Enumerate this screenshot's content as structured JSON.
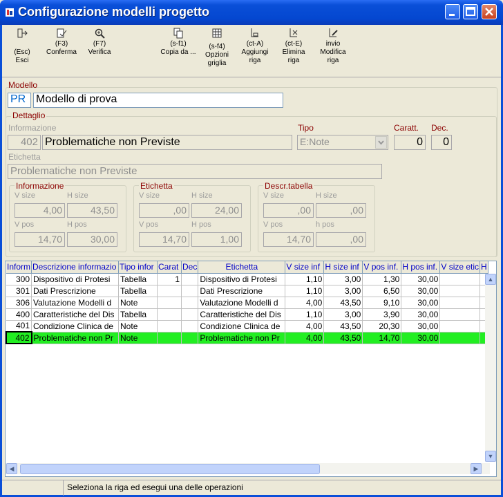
{
  "window": {
    "title": "Configurazione modelli progetto"
  },
  "toolbar": [
    {
      "shortcut": "(Esc)",
      "label": "Esci",
      "icon": "exit-icon"
    },
    {
      "shortcut": "(F3)",
      "label": "Conferma",
      "icon": "confirm-icon"
    },
    {
      "shortcut": "(F7)",
      "label": "Verifica",
      "icon": "verify-icon"
    },
    {
      "shortcut": "(s-f1)",
      "label": "Copia da ...",
      "icon": "copy-icon"
    },
    {
      "shortcut": "(s-f4)",
      "label": "Opzioni griglia",
      "icon": "grid-options-icon"
    },
    {
      "shortcut": "(ct-A)",
      "label": "Aggiungi riga",
      "icon": "add-row-icon"
    },
    {
      "shortcut": "(ct-E)",
      "label": "Elimina riga",
      "icon": "delete-row-icon"
    },
    {
      "shortcut": "invio",
      "label": "Modifica riga",
      "icon": "edit-row-icon"
    }
  ],
  "modello": {
    "label": "Modello",
    "code": "PR",
    "name": "Modello di prova"
  },
  "dettaglio": {
    "label": "Dettaglio",
    "informazione_label": "Informazione",
    "info_code": "402",
    "info_desc": "Problematiche non Previste",
    "tipo_label": "Tipo",
    "tipo_value": "E:Note",
    "caratt_label": "Caratt.",
    "caratt_value": "0",
    "dec_label": "Dec.",
    "dec_value": "0",
    "etichetta_label": "Etichetta",
    "etichetta_value": "Problematiche non Previste"
  },
  "groups": {
    "informazione": {
      "title": "Informazione",
      "vsize_label": "V size",
      "hsize_label": "H size",
      "vpos_label": "V pos",
      "hpos_label": "H pos",
      "vsize": "4,00",
      "hsize": "43,50",
      "vpos": "14,70",
      "hpos": "30,00"
    },
    "etichetta": {
      "title": "Etichetta",
      "vsize_label": "V size",
      "hsize_label": "H size",
      "vpos_label": "V pos",
      "hpos_label": "H pos",
      "vsize": ",00",
      "hsize": "24,00",
      "vpos": "14,70",
      "hpos": "1,00"
    },
    "descr": {
      "title": "Descr.tabella",
      "vsize_label": "V size",
      "hsize_label": "H size",
      "vpos_label": "V pos",
      "hpos_label": "h pos",
      "vsize": ",00",
      "hsize": ",00",
      "vpos": "14,70",
      "hpos": ",00"
    }
  },
  "grid": {
    "headers": [
      "Inform",
      "Descrizione informazio",
      "Tipo infor",
      "Carat",
      "Dec",
      "Etichetta",
      "V size inf",
      "H size inf",
      "V pos inf.",
      "H pos inf.",
      "V size etic",
      "H"
    ],
    "rows": [
      [
        "300",
        "Dispositivo di Protesi",
        "Tabella",
        "1",
        "",
        "Dispositivo di Protesi",
        "1,10",
        "3,00",
        "1,30",
        "30,00",
        "",
        ""
      ],
      [
        "301",
        "Dati Prescrizione",
        "Tabella",
        "",
        "",
        "Dati Prescrizione",
        "1,10",
        "3,00",
        "6,50",
        "30,00",
        "",
        ""
      ],
      [
        "306",
        "Valutazione Modelli d",
        "Note",
        "",
        "",
        "Valutazione Modelli d",
        "4,00",
        "43,50",
        "9,10",
        "30,00",
        "",
        ""
      ],
      [
        "400",
        "Caratteristiche del Dis",
        "Tabella",
        "",
        "",
        "Caratteristiche del Dis",
        "1,10",
        "3,00",
        "3,90",
        "30,00",
        "",
        ""
      ],
      [
        "401",
        "Condizione Clinica de",
        "Note",
        "",
        "",
        "Condizione Clinica de",
        "4,00",
        "43,50",
        "20,30",
        "30,00",
        "",
        ""
      ],
      [
        "402",
        "Problematiche non Pr",
        "Note",
        "",
        "",
        "Problematiche non Pr",
        "4,00",
        "43,50",
        "14,70",
        "30,00",
        "",
        ""
      ]
    ],
    "selected_row": 5
  },
  "status": {
    "message": "Seleziona la riga ed esegui una delle operazioni"
  },
  "colors": {
    "titlebar": "#0a4fd8",
    "selected_row": "#22ee22",
    "label_red": "#8b0000",
    "header_text": "#0000c8"
  }
}
